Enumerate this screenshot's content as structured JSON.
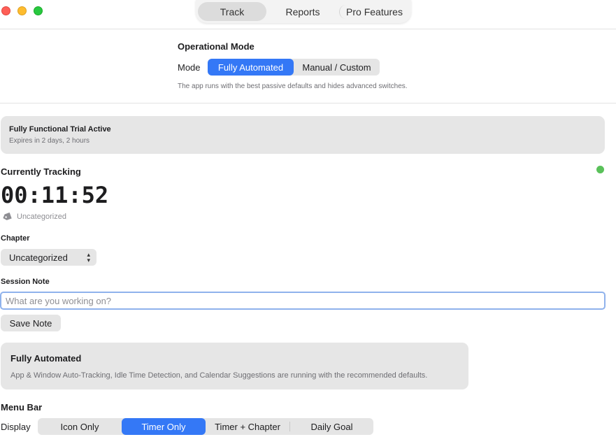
{
  "window": {
    "tabs": [
      {
        "label": "Track",
        "active": true
      },
      {
        "label": "Reports",
        "active": false
      },
      {
        "label": "Pro Features",
        "active": false
      }
    ]
  },
  "operational_mode": {
    "title": "Operational Mode",
    "mode_label": "Mode",
    "options": [
      "Fully Automated",
      "Manual / Custom"
    ],
    "selected": "Fully Automated",
    "description": "The app runs with the best passive defaults and hides advanced switches."
  },
  "trial": {
    "title": "Fully Functional Trial Active",
    "subtitle": "Expires in 2 days, 2 hours"
  },
  "tracking": {
    "title": "Currently Tracking",
    "timer": "00:11:52",
    "category": "Uncategorized",
    "status_color": "#5ac15a"
  },
  "chapter": {
    "label": "Chapter",
    "selected": "Uncategorized"
  },
  "session_note": {
    "label": "Session Note",
    "placeholder": "What are you working on?",
    "value": "",
    "save_label": "Save Note"
  },
  "automation_card": {
    "title": "Fully Automated",
    "description": "App & Window Auto-Tracking, Idle Time Detection, and Calendar Suggestions are running with the recommended defaults."
  },
  "menu_bar": {
    "title": "Menu Bar",
    "display_label": "Display",
    "options": [
      "Icon Only",
      "Timer Only",
      "Timer + Chapter",
      "Daily Goal"
    ],
    "selected": "Timer Only"
  },
  "colors": {
    "accent": "#3478f6",
    "close": "#fe5f57",
    "minimize": "#febc2e",
    "maximize": "#28c840"
  }
}
